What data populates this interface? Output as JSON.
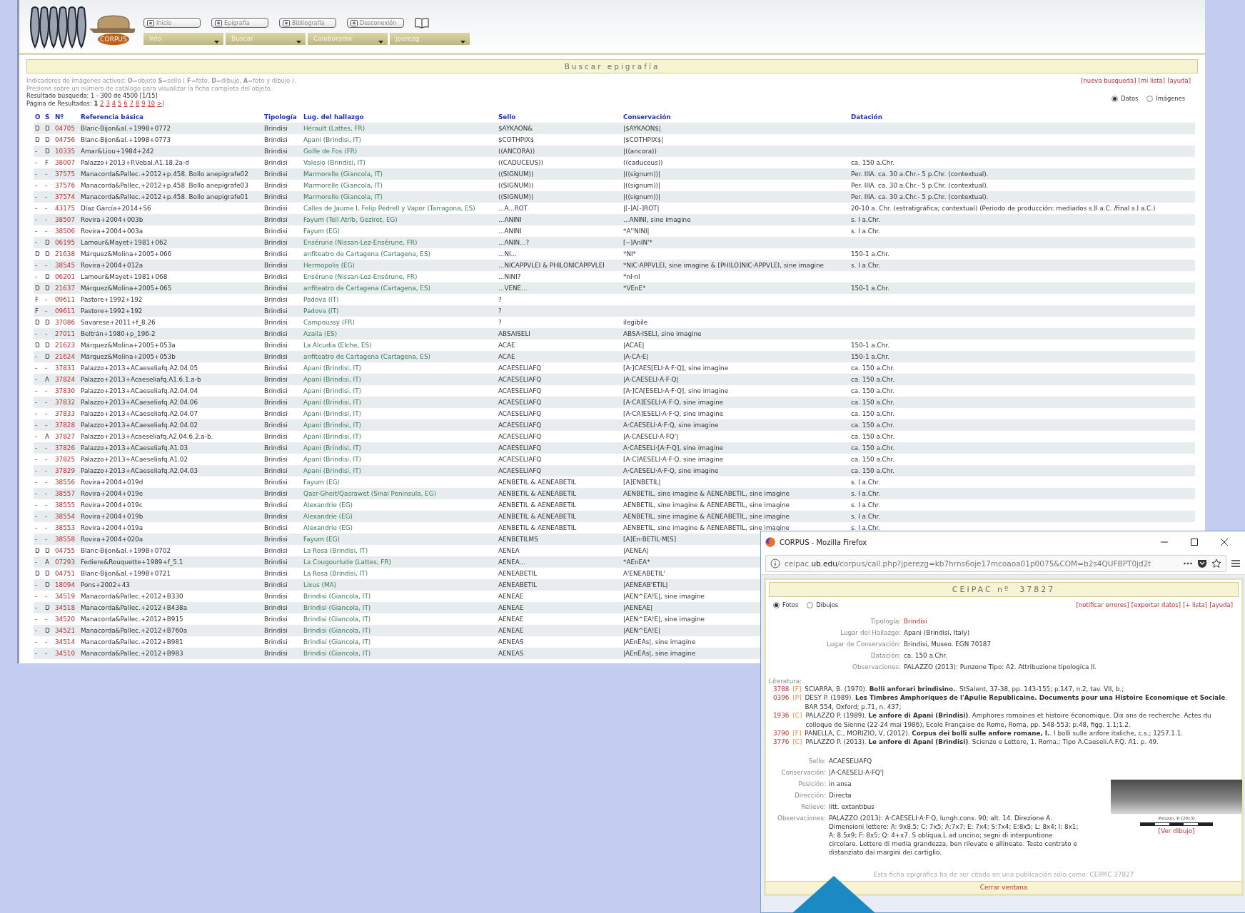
{
  "logo": {
    "text": "CORPUS"
  },
  "nav_buttons": [
    "Inicio",
    "Epigrafía",
    "Bibliografía",
    "Desconexión"
  ],
  "menus": [
    "Info",
    "Buscar",
    "Colaborador",
    "jperezg"
  ],
  "search": {
    "title": "Buscar epigrafía",
    "legend": "Indicadores de imágenes activos: **O**=objeto **S**=sello ( **F**=foto, **D**=dibujo, **A**=foto y dibujo ).",
    "hint": "Presione sobre un número de catálogo para visualizar la ficha completa del objeto.",
    "links": [
      "[nueva busqueda]",
      "[mi lista]",
      "[ayuda]"
    ],
    "result": "Resultado búsqueda: 1 - 300 de 4500 [1/15]",
    "pages_label": "Página de Resultados:",
    "pages": [
      {
        "label": "1",
        "selected": true
      },
      {
        "label": "2",
        "selected": false
      },
      {
        "label": "3",
        "selected": false
      },
      {
        "label": "4",
        "selected": false
      },
      {
        "label": "5",
        "selected": false
      },
      {
        "label": "6",
        "selected": false
      },
      {
        "label": "7",
        "selected": false
      },
      {
        "label": "8",
        "selected": false
      },
      {
        "label": "9",
        "selected": false
      },
      {
        "label": "10",
        "selected": false
      },
      {
        "label": ">|",
        "selected": false
      }
    ],
    "view_options": [
      {
        "label": "Datos",
        "selected": true
      },
      {
        "label": "Imágenes",
        "selected": false
      }
    ]
  },
  "table": {
    "columns": [
      "O",
      "S",
      "Nº",
      "Referencia básica",
      "Tipología",
      "Lug. del hallazgo",
      "Sello",
      "Conservación",
      "Datación"
    ],
    "rows": [
      {
        "o": "D",
        "s": "D",
        "no": "04705",
        "ref": "Blanc-Bijon&al.+1998+0772",
        "tipologia": "Brindisi",
        "lugar": "Hérault (Lattes, FR)",
        "sello": "$AYKAON&",
        "conservacion": "|$AYKAON$|"
      },
      {
        "o": "D",
        "s": "D",
        "no": "04756",
        "ref": "Blanc-Bijon&al.+1998+0773",
        "tipologia": "Brindisi",
        "lugar": "Apani (Brindisi, IT)",
        "sello": "$COTHPIX$",
        "conservacion": "|$COTHPIX$|"
      },
      {
        "o": "-",
        "s": "D",
        "no": "10335",
        "ref": "Amar&Liou+1984+242",
        "tipologia": "Brindisi",
        "lugar": "Golfe de Fos (FR)",
        "sello": "((ANCORA))",
        "conservacion": "|((ancora))"
      },
      {
        "o": "-",
        "s": "F",
        "no": "38007",
        "ref": "Palazzo+2013+P.Vebal.A1.18.2a-d",
        "tipologia": "Brindisi",
        "lugar": "Valesio (Brindisi, IT)",
        "sello": "((CADUCEUS))",
        "conservacion": "((caduceus))",
        "datacion": "ca. 150 a.Chr."
      },
      {
        "o": "-",
        "s": "-",
        "no": "37575",
        "ref": "Manacorda&Pallec.+2012+p.458. Bollo anepigrafe02",
        "tipologia": "Brindisi",
        "lugar": "Marmorelle (Giancola, IT)",
        "sello": "((SIGNUM))",
        "conservacion": "|((signum))|",
        "datacion": "Per. IIIA. ca. 30 a.Chr.- 5 p.Chr. (contextual)."
      },
      {
        "o": "-",
        "s": "-",
        "no": "37576",
        "ref": "Manacorda&Pallec.+2012+p.458. Bollo anepigrafe03",
        "tipologia": "Brindisi",
        "lugar": "Marmorelle (Giancola, IT)",
        "sello": "((SIGNUM))",
        "conservacion": "|((signum))|",
        "datacion": "Per. IIIA. ca. 30 a.Chr.- 5 p.Chr. (contextual)."
      },
      {
        "o": "-",
        "s": "-",
        "no": "37574",
        "ref": "Manacorda&Pallec.+2012+p.458. Bollo anepigrafe01",
        "tipologia": "Brindisi",
        "lugar": "Marmorelle (Giancola, IT)",
        "sello": "((SIGNUM))",
        "conservacion": "|((signum))|",
        "datacion": "Per. IIIA. ca. 30 a.Chr.- 5 p.Chr. (contextual)."
      },
      {
        "o": "-",
        "s": "-",
        "no": "43175",
        "ref": "Díaz García+2014+S6",
        "tipologia": "Brindisi",
        "lugar": "Calles de Jaume I, Felip Pedrell y Vapor (Tarragona, ES)",
        "sello": "...A...ROT",
        "conservacion": "|[-]A[-]ROT|",
        "datacion": "20-10 a. Chr. (estratigráfica; contextual) (Periodo de producción: mediados s.II a.C. /final s.I a.C.)"
      },
      {
        "o": "-",
        "s": "-",
        "no": "38507",
        "ref": "Rovira+2004+003b",
        "tipologia": "Brindisi",
        "lugar": "Fayum (Tell Atrîb, Gezîret, EG)",
        "sello": "...ANINI",
        "conservacion": "...ANINI, sine imagine",
        "datacion": "s. I a.Chr."
      },
      {
        "o": "-",
        "s": "-",
        "no": "38506",
        "ref": "Rovira+2004+003a",
        "tipologia": "Brindisi",
        "lugar": "Fayum (EG)",
        "sello": "...ANINI",
        "conservacion": "*A''NINI|",
        "datacion": "s. I a.Chr."
      },
      {
        "o": "-",
        "s": "D",
        "no": "06195",
        "ref": "Lamour&Mayet+1981+062",
        "tipologia": "Brindisi",
        "lugar": "Ensérune (Nissan-Lez-Ensérune, FR)",
        "sello": "...ANIN...?",
        "conservacion": "[--]AnIN'*"
      },
      {
        "o": "D",
        "s": "D",
        "no": "21638",
        "ref": "Márquez&Molina+2005+066",
        "tipologia": "Brindisi",
        "lugar": "anfiteatro de Cartagena (Cartagena, ES)",
        "sello": "...NI...",
        "conservacion": "*NI*",
        "datacion": "150-1 a.Chr."
      },
      {
        "o": "-",
        "s": "-",
        "no": "38545",
        "ref": "Rovira+2004+012a",
        "tipologia": "Brindisi",
        "lugar": "Hermopolis (EG)",
        "sello": "...NICAPPVLEI & PHILONICAPPVLEI",
        "conservacion": "*NIC·APPVLEI, sine imagine & [PHILO]NIC·APPVLEI, sine imagine",
        "datacion": "s. I a.Chr."
      },
      {
        "o": "-",
        "s": "D",
        "no": "06201",
        "ref": "Lamour&Mayet+1981+068",
        "tipologia": "Brindisi",
        "lugar": "Ensérune (Nissan-Lez-Ensérune, FR)",
        "sello": "...NINI?",
        "conservacion": "*nI·nI"
      },
      {
        "o": "D",
        "s": "D",
        "no": "21637",
        "ref": "Márquez&Molina+2005+065",
        "tipologia": "Brindisi",
        "lugar": "anfiteatro de Cartagena (Cartagena, ES)",
        "sello": "...VENE...",
        "conservacion": "*VEnE*",
        "datacion": "150-1 a.Chr."
      },
      {
        "o": "F",
        "s": "-",
        "no": "09611",
        "ref": "Pastore+1992+192",
        "tipologia": "Brindisi",
        "lugar": "Padova (IT)",
        "sello": "?"
      },
      {
        "o": "F",
        "s": "-",
        "no": "09611",
        "ref": "Pastore+1992+192",
        "tipologia": "Brindisi",
        "lugar": "Padova (IT)",
        "sello": "?"
      },
      {
        "o": "D",
        "s": "D",
        "no": "37086",
        "ref": "Savarese+2011+f_8.26",
        "tipologia": "Brindisi",
        "lugar": "Campoussy (FR)",
        "sello": "?",
        "conservacion": "ilegibile"
      },
      {
        "o": "-",
        "s": "-",
        "no": "27011",
        "ref": "Beltrán+1980+p_196-2",
        "tipologia": "Brindisi",
        "lugar": "Azaila (ES)",
        "sello": "ABSAISELI",
        "conservacion": "ABSA·ISELI, sine imagine"
      },
      {
        "o": "D",
        "s": "D",
        "no": "21623",
        "ref": "Márquez&Molina+2005+053a",
        "tipologia": "Brindisi",
        "lugar": "La Alcudia (Elche, ES)",
        "sello": "ACAE",
        "conservacion": "|ACAE|",
        "datacion": "150-1 a.Chr."
      },
      {
        "o": "-",
        "s": "D",
        "no": "21624",
        "ref": "Márquez&Molina+2005+053b",
        "tipologia": "Brindisi",
        "lugar": "anfiteatro de Cartagena (Cartagena, ES)",
        "sello": "ACAE",
        "conservacion": "|A·CA·E|",
        "datacion": "150-1 a.Chr."
      },
      {
        "o": "-",
        "s": "-",
        "no": "37831",
        "ref": "Palazzo+2013+ACaeseliafq.A2.04.05",
        "tipologia": "Brindisi",
        "lugar": "Apani (Brindisi, IT)",
        "sello": "ACAESELIAFQ",
        "conservacion": "[A·]CAES[ELI·A·F·Q], sine imagine",
        "datacion": "ca. 150 a.Chr."
      },
      {
        "o": "-",
        "s": "A",
        "no": "37824",
        "ref": "Palazzo+2013+Acaeseliafq.A1.6.1.a-b",
        "tipologia": "Brindisi",
        "lugar": "Apani (Brindisi, IT)",
        "sello": "ACAESELIAFQ",
        "conservacion": "|A·CAESELI·A·F·Q|",
        "datacion": "ca. 150 a.Chr."
      },
      {
        "o": "-",
        "s": "-",
        "no": "37830",
        "ref": "Palazzo+2013+ACaeseliafq.A2.04.04",
        "tipologia": "Brindisi",
        "lugar": "Apani (Brindisi, IT)",
        "sello": "ACAESELIAFQ",
        "conservacion": "[A·]CA[ESELI·A·F·Q], sine imagine",
        "datacion": "ca. 150 a.Chr."
      },
      {
        "o": "-",
        "s": "-",
        "no": "37832",
        "ref": "Palazzo+2013+ACaeseliafq.A2.04.06",
        "tipologia": "Brindisi",
        "lugar": "Apani (Brindisi, IT)",
        "sello": "ACAESELIAFQ",
        "conservacion": "[A·CA]ESELI·A·F·Q, sine imagine",
        "datacion": "ca. 150 a.Chr."
      },
      {
        "o": "-",
        "s": "-",
        "no": "37833",
        "ref": "Palazzo+2013+ACaeseliafq.A2.04.07",
        "tipologia": "Brindisi",
        "lugar": "Apani (Brindisi, IT)",
        "sello": "ACAESELIAFQ",
        "conservacion": "[A·CA]ESELI·A·F·Q, sine imagine",
        "datacion": "ca. 150 a.Chr."
      },
      {
        "o": "-",
        "s": "-",
        "no": "37828",
        "ref": "Palazzo+2013+ACaeseliafq.A2.04.02",
        "tipologia": "Brindisi",
        "lugar": "Apani (Brindisi, IT)",
        "sello": "ACAESELIAFQ",
        "conservacion": "A·CAESELI·A·F·Q, sine imagine",
        "datacion": "ca. 150 a.Chr."
      },
      {
        "o": "-",
        "s": "A",
        "no": "37827",
        "ref": "Palazzo+2013+Acaeseliafq.A2.04.6.2.a-b.",
        "tipologia": "Brindisi",
        "lugar": "Apani (Brindisi, IT)",
        "sello": "ACAESELIAFQ",
        "conservacion": "|A·CAESELI·A·FQ'|",
        "datacion": "ca. 150 a.Chr."
      },
      {
        "o": "-",
        "s": "-",
        "no": "37826",
        "ref": "Palazzo+2013+ACaeseliafq.A1.03",
        "tipologia": "Brindisi",
        "lugar": "Apani (Brindisi, IT)",
        "sello": "ACAESELIAFQ",
        "conservacion": "A·CAESELI·[A·F·Q], sine imagine",
        "datacion": "ca. 150 a.Chr."
      },
      {
        "o": "-",
        "s": "-",
        "no": "37825",
        "ref": "Palazzo+2013+ACaeseliafq.A1.02",
        "tipologia": "Brindisi",
        "lugar": "Apani (Brindisi, IT)",
        "sello": "ACAESELIAFQ",
        "conservacion": "[A·C]AESELI·A·F·Q, sine imagine",
        "datacion": "ca. 150 a.Chr."
      },
      {
        "o": "-",
        "s": "-",
        "no": "37829",
        "ref": "Palazzo+2013+ACaeseliafq.A2.04.03",
        "tipologia": "Brindisi",
        "lugar": "Apani (Brindisi, IT)",
        "sello": "ACAESELIAFQ",
        "conservacion": "A·CAESELI·A·F·Q, sine imagine",
        "datacion": "ca. 150 a.Chr."
      },
      {
        "o": "-",
        "s": "-",
        "no": "38556",
        "ref": "Rovira+2004+019d",
        "tipologia": "Brindisi",
        "lugar": "Fayum (EG)",
        "sello": "AENBETIL & AENEABETIL",
        "conservacion": "[A]ENBETIL|",
        "datacion": "s. I a.Chr."
      },
      {
        "o": "-",
        "s": "-",
        "no": "38557",
        "ref": "Rovira+2004+019e",
        "tipologia": "Brindisi",
        "lugar": "Qasr-Gheit/Qasrawet (Sinai Peninsula, EG)",
        "sello": "AENBETIL & AENEABETIL",
        "conservacion": "AENBETIL, sine imagine & AENEABETIL, sine imagine",
        "datacion": "s. I a.Chr."
      },
      {
        "o": "-",
        "s": "-",
        "no": "38555",
        "ref": "Rovira+2004+019c",
        "tipologia": "Brindisi",
        "lugar": "Alexandrie (EG)",
        "sello": "AENBETIL & AENEABETIL",
        "conservacion": "AENBETIL, sine imagine & AENEABETIL, sine imagine",
        "datacion": "s. I a.Chr."
      },
      {
        "o": "-",
        "s": "-",
        "no": "38554",
        "ref": "Rovira+2004+019b",
        "tipologia": "Brindisi",
        "lugar": "Alexandrie (EG)",
        "sello": "AENBETIL & AENEABETIL",
        "conservacion": "AENBETIL, sine imagine & AENEABETIL, sine imagine",
        "datacion": "s. I a.Chr."
      },
      {
        "o": "-",
        "s": "-",
        "no": "38553",
        "ref": "Rovira+2004+019a",
        "tipologia": "Brindisi",
        "lugar": "Alexandrie (EG)",
        "sello": "AENBETIL & AENEABETIL",
        "conservacion": "AENBETIL, sine imagine & AENEABETIL, sine imagine",
        "datacion": "s. I a.Chr."
      },
      {
        "o": "-",
        "s": "-",
        "no": "38558",
        "ref": "Rovira+2004+020a",
        "tipologia": "Brindisi",
        "lugar": "Fayum (EG)",
        "sello": "AENBETILMS",
        "conservacion": "[A]En·BETIL·M[S]"
      },
      {
        "o": "D",
        "s": "D",
        "no": "04755",
        "ref": "Blanc-Bijon&al.+1998+0702",
        "tipologia": "Brindisi",
        "lugar": "La Rosa (Brindisi, IT)",
        "sello": "AENEA",
        "conservacion": "|AENEA|"
      },
      {
        "o": "-",
        "s": "A",
        "no": "07293",
        "ref": "Fediere&Rouquette+1989+f_5.1",
        "tipologia": "Brindisi",
        "lugar": "La Cougourlude (Lattes, FR)",
        "sello": "AENEA...",
        "conservacion": "*AEnEA*"
      },
      {
        "o": "D",
        "s": "D",
        "no": "04751",
        "ref": "Blanc-Bijon&al.+1998+0721",
        "tipologia": "Brindisi",
        "lugar": "La Rosa (Brindisi, IT)",
        "sello": "AENEABETIL",
        "conservacion": "A'ENEABETIL'"
      },
      {
        "o": "-",
        "s": "D",
        "no": "18094",
        "ref": "Pons+2002+43",
        "tipologia": "Brindisi",
        "lugar": "Lixus (MA)",
        "sello": "AENEABETIL",
        "conservacion": "|AENEAB'ETIL|"
      },
      {
        "o": "-",
        "s": "-",
        "no": "34519",
        "ref": "Manacorda&Pallec.+2012+B330",
        "tipologia": "Brindisi",
        "lugar": "Brindisi (Giancola, IT)",
        "sello": "AENEAE",
        "conservacion": "|AEN^EA!E|, sine imagine"
      },
      {
        "o": "-",
        "s": "D",
        "no": "34518",
        "ref": "Manacorda&Pallec.+2012+B438a",
        "tipologia": "Brindisi",
        "lugar": "Brindisi (Giancola, IT)",
        "sello": "AENEAE",
        "conservacion": "|AENEAE|"
      },
      {
        "o": "-",
        "s": "-",
        "no": "34520",
        "ref": "Manacorda&Pallec.+2012+B915",
        "tipologia": "Brindisi",
        "lugar": "Brindisi (Giancola, IT)",
        "sello": "AENEAE",
        "conservacion": "|AEN^EA!E|, sine imagine"
      },
      {
        "o": "-",
        "s": "D",
        "no": "34521",
        "ref": "Manacorda&Pallec.+2012+B760a",
        "tipologia": "Brindisi",
        "lugar": "Brindisi (Giancola, IT)",
        "sello": "AENEAE",
        "conservacion": "|AEN^EA!E|"
      },
      {
        "o": "-",
        "s": "-",
        "no": "34514",
        "ref": "Manacorda&Pallec.+2012+B981",
        "tipologia": "Brindisi",
        "lugar": "Brindisi (Giancola, IT)",
        "sello": "AENEAS",
        "conservacion": "|AEnEAs|, sine imagine"
      },
      {
        "o": "-",
        "s": "-",
        "no": "34510",
        "ref": "Manacorda&Pallec.+2012+B983",
        "tipologia": "Brindisi",
        "lugar": "Brindisi (Giancola, IT)",
        "sello": "AENEAS",
        "conservacion": "|AEnEAs|, sine imagine"
      }
    ]
  },
  "popup": {
    "window_title": "CORPUS - Mozilla Firefox",
    "url": "ceipac.**ub.edu**/corpus/call.php?jperezg=kb7hrns6oje17mcoaoa01p0075&COM=b2s4QUFBPT0jd2t",
    "title": "CEIPAC nº  37827",
    "view_options": [
      {
        "label": "Fotos",
        "selected": true
      },
      {
        "label": "Dibujos",
        "selected": false
      }
    ],
    "links": [
      "[notificar errores]",
      "[exportar datos]",
      "[+ lista]",
      "[ayuda]"
    ],
    "fields": [
      {
        "label": "Tipología:",
        "value": "Brindisi",
        "kind": "link"
      },
      {
        "label": "Lugar del Hallazgo:",
        "value": "Apani (Brindisi, Italy)",
        "kind": "text"
      },
      {
        "label": "Lugar de Conservación:",
        "value": "Brindisi, Museo. EGN 70187",
        "kind": "text"
      },
      {
        "label": "Datación:",
        "value": "ca. 150 a.Chr.",
        "kind": "text"
      },
      {
        "label": "Observaciones:",
        "value": "PALAZZO (2013): Punzone Tipo: A2. Attribuzione tipologica II.",
        "kind": "text"
      }
    ],
    "literature_label": "Literatura:",
    "literature": [
      {
        "id": "3788",
        "type": "[F]",
        "text": "SCIARRA, B. (1970). **Bolli anforari brindisino.**. StSalent, 37-38, pp. 143-155;  p.147, n.2, tav. VII, b.;"
      },
      {
        "id": "0396",
        "type": "[P]",
        "text": "DESY P. (1989). **Les Timbres Amphoriques de l'Apulie Republicaine. Documents pour una Histoire Economique et Sociale**. BAR 554, Oxford;  p.71, n. 437;"
      },
      {
        "id": "1936",
        "type": "[C]",
        "text": "PALAZZO P. (1989). **Le anfore di Apani (Brindisi)**. Amphores romaines et histoire économique. Dix ans de recherche. Actes du colloque de Sienne (22-24 mai 1986), Ecole Française de Rome, Roma, pp. 548-553;  p.48, figg. 1.1;1.2."
      },
      {
        "id": "3790",
        "type": "[F]",
        "text": "PANELLA, C., MORIZIO, V, (2012). **Corpus dei bolli sulle anfore romane, I.**. I bolli sulle anfore italiche, c.s.;  1257.1.1."
      },
      {
        "id": "3776",
        "type": "[C]",
        "text": "PALAZZO P. (2013). **Le anfore di Apani (Brindisi)**. Scienze e Lettere, 1. Roma.;  Tipo A.Caeseli.A.F.Q. A1. p. 49."
      }
    ],
    "stamp_fields": [
      {
        "label": "Sello:",
        "value": "ACAESELIAFQ"
      },
      {
        "label": "Conservación:",
        "value": "|A·CAESELI·A·FQ'|"
      },
      {
        "label": "Posición:",
        "value": "in ansa"
      },
      {
        "label": "Dirección:",
        "value": "Directa"
      },
      {
        "label": "Relieve:",
        "value": "litt. extantibus"
      },
      {
        "label": "Observaciones:",
        "value": "PALAZZO (2013): A·CAESELI·A·F·Q, lungh.cons. 90; alt. 14. Direzione A. Dimensioni lettere: A: 9x8.5; C: 7x5; A:7x7; E: 7x4; S:7x4; E:8x5; L: 8x4; I: 8x1; A: 8.5x9; F: 8x5; Q: 4+x7. S obliqua.L ad uncino; segni di interpuntione circolare. Lettere di media grandezza, ben rilevate e allineate. Testo centrato e distanziato dai margini dei cartiglio."
      }
    ],
    "photo_caption": "Palazzo, P. (2013)",
    "drawing_link": "[Ver dibujo]",
    "citation": "Esta ficha epigráfica ha de ser citada en una publicación sólo como: CEIPAC 37827",
    "close": "Cerrar ventana"
  }
}
